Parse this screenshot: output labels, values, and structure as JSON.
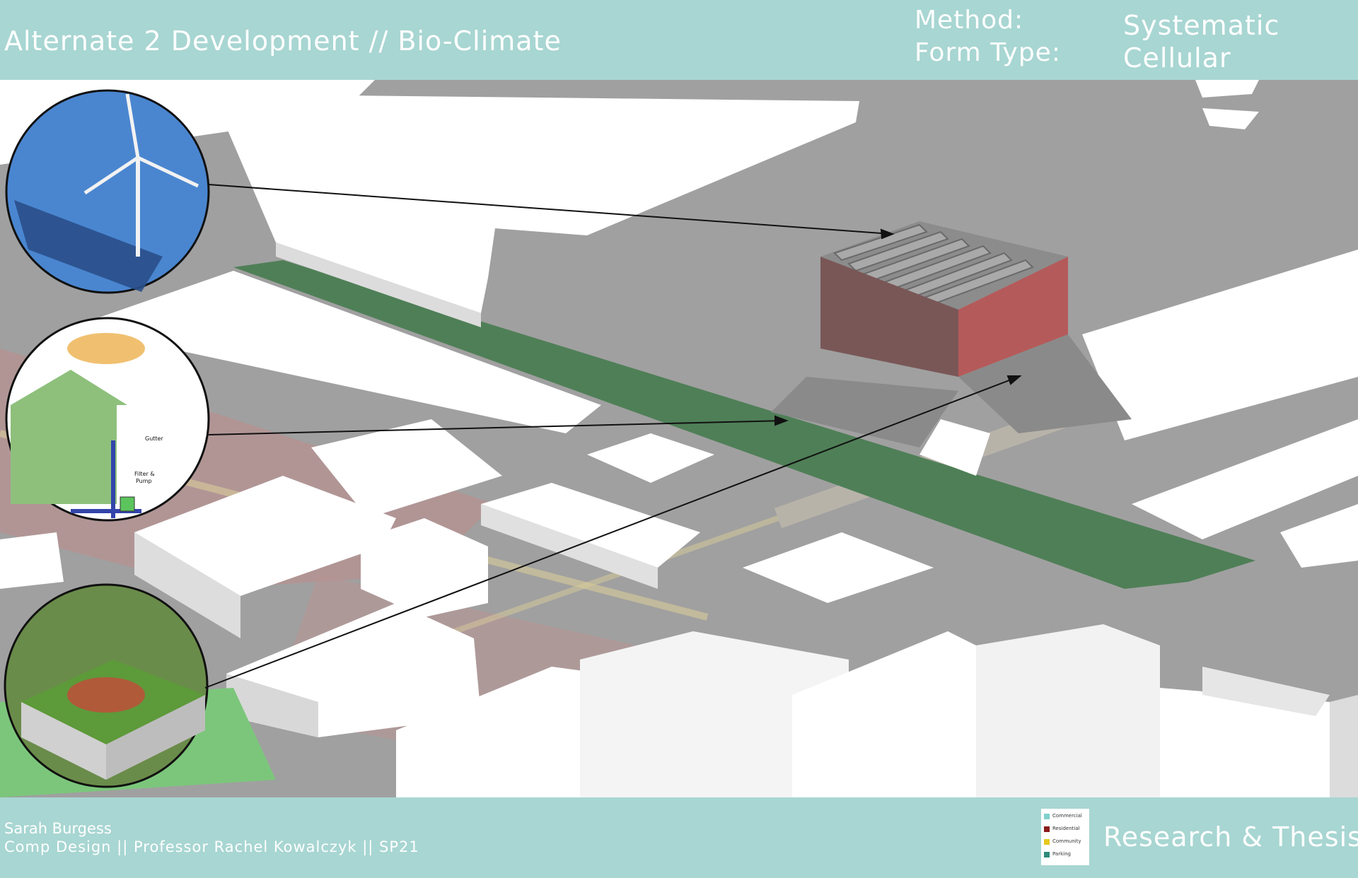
{
  "header": {
    "title": "Alternate 2 Development // Bio-Climate",
    "method_label": "Method:",
    "form_type_label": "Form Type:",
    "method_value": "Systematic",
    "form_type_value": "Cellular"
  },
  "footer": {
    "author": "Sarah Burgess",
    "course": "Comp Design || Professor Rachel Kowalczyk || SP21",
    "program": "Research & Thesis"
  },
  "legend": {
    "items": [
      {
        "label": "Commercial",
        "color": "#7fd0cc"
      },
      {
        "label": "Residential",
        "color": "#8b1a1a"
      },
      {
        "label": "Community",
        "color": "#e6c820"
      },
      {
        "label": "Parking",
        "color": "#2e8b7a"
      }
    ]
  },
  "callouts": {
    "rain_label_1": "Gutter",
    "rain_label_2": "Filter &",
    "rain_label_3": "Pump"
  },
  "colors": {
    "header_bg": "#a8d6d2",
    "green_strip": "#4f7f57",
    "building_wall": "#b55a5a"
  }
}
